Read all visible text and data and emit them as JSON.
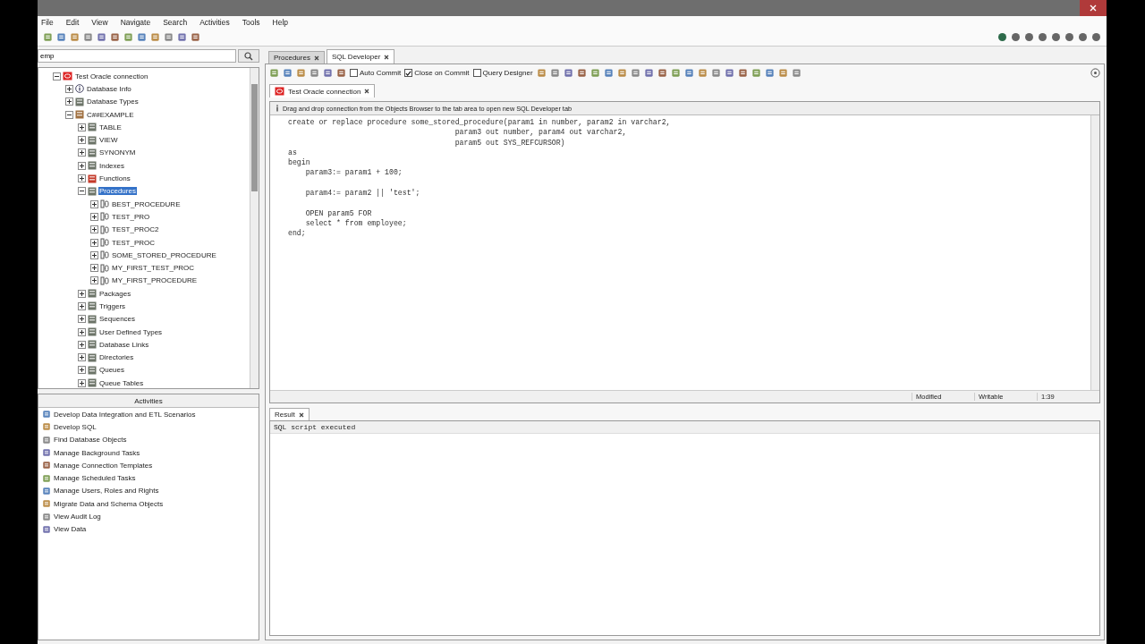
{
  "menu": [
    "File",
    "Edit",
    "View",
    "Navigate",
    "Search",
    "Activities",
    "Tools",
    "Help"
  ],
  "navigator": {
    "search": {
      "value": "emp"
    },
    "tree": [
      {
        "label": "Test Oracle connection",
        "kind": "connection",
        "expanded": true,
        "selected": false,
        "children": [
          {
            "label": "Database Info",
            "kind": "info",
            "expanded": false,
            "selected": false
          },
          {
            "label": "Database Types",
            "kind": "category",
            "expanded": false,
            "selected": false
          },
          {
            "label": "C##EXAMPLE",
            "kind": "schema",
            "expanded": true,
            "selected": false,
            "children": [
              {
                "label": "TABLE",
                "kind": "category",
                "expanded": false,
                "selected": false
              },
              {
                "label": "VIEW",
                "kind": "category",
                "expanded": false,
                "selected": false
              },
              {
                "label": "SYNONYM",
                "kind": "category",
                "expanded": false,
                "selected": false
              },
              {
                "label": "Indexes",
                "kind": "category",
                "expanded": false,
                "selected": false
              },
              {
                "label": "Functions",
                "kind": "function",
                "expanded": false,
                "selected": false
              },
              {
                "label": "Procedures",
                "kind": "category",
                "expanded": true,
                "selected": true,
                "children": [
                  {
                    "label": "BEST_PROCEDURE",
                    "kind": "procedure",
                    "expanded": false,
                    "selected": false
                  },
                  {
                    "label": "TEST_PRO",
                    "kind": "procedure",
                    "expanded": false,
                    "selected": false
                  },
                  {
                    "label": "TEST_PROC2",
                    "kind": "procedure",
                    "expanded": false,
                    "selected": false
                  },
                  {
                    "label": "TEST_PROC",
                    "kind": "procedure",
                    "expanded": false,
                    "selected": false
                  },
                  {
                    "label": "SOME_STORED_PROCEDURE",
                    "kind": "procedure",
                    "expanded": false,
                    "selected": false
                  },
                  {
                    "label": "MY_FIRST_TEST_PROC",
                    "kind": "procedure",
                    "expanded": false,
                    "selected": false
                  },
                  {
                    "label": "MY_FIRST_PROCEDURE",
                    "kind": "procedure",
                    "expanded": false,
                    "selected": false
                  }
                ]
              },
              {
                "label": "Packages",
                "kind": "category",
                "expanded": false,
                "selected": false
              },
              {
                "label": "Triggers",
                "kind": "category",
                "expanded": false,
                "selected": false
              },
              {
                "label": "Sequences",
                "kind": "category",
                "expanded": false,
                "selected": false
              },
              {
                "label": "User Defined Types",
                "kind": "category",
                "expanded": false,
                "selected": false
              },
              {
                "label": "Database Links",
                "kind": "category",
                "expanded": false,
                "selected": false
              },
              {
                "label": "Directories",
                "kind": "category",
                "expanded": false,
                "selected": false
              },
              {
                "label": "Queues",
                "kind": "category",
                "expanded": false,
                "selected": false
              },
              {
                "label": "Queue Tables",
                "kind": "category",
                "expanded": false,
                "selected": false
              }
            ]
          }
        ]
      }
    ]
  },
  "activities": {
    "title": "Activities",
    "items": [
      "Develop Data Integration and ETL Scenarios",
      "Develop SQL",
      "Find Database Objects",
      "Manage Background Tasks",
      "Manage Connection Templates",
      "Manage Scheduled Tasks",
      "Manage Users, Roles and Rights",
      "Migrate Data and Schema Objects",
      "View Audit Log",
      "View Data"
    ]
  },
  "document_tabs": [
    {
      "label": "Procedures",
      "selected": false
    },
    {
      "label": "SQL Developer",
      "selected": true
    }
  ],
  "sql_toolbar": {
    "checkboxes": [
      {
        "label": "Auto Commit",
        "checked": false
      },
      {
        "label": "Close on Commit",
        "checked": true
      },
      {
        "label": "Query Designer",
        "checked": false
      }
    ]
  },
  "connection_tab": {
    "label": "Test Oracle connection"
  },
  "info_bar": "Drag and drop connection from the Objects Browser to the tab area to open new SQL Developer tab",
  "editor": {
    "blocks": [
      [
        "create or replace procedure some_stored_procedure(param1 in number, param2 in varchar2,",
        "                                      param3 out number, param4 out varchar2,",
        "                                      param5 out SYS_REFCURSOR)",
        "as",
        "begin",
        "    param3:= param1 + 100;"
      ],
      [
        "    param4:= param2 || 'test';"
      ],
      [
        "    OPEN param5 FOR",
        "    select * from employee;",
        "end;"
      ]
    ]
  },
  "status": [
    "Modified",
    "Writable",
    "1:39"
  ],
  "result": {
    "tab": "Result",
    "message": "SQL script executed"
  }
}
